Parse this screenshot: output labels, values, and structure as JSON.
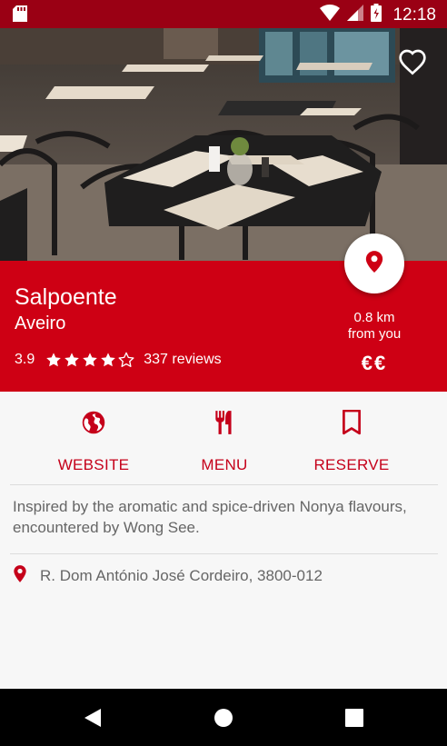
{
  "status_bar": {
    "time": "12:18"
  },
  "restaurant": {
    "name": "Salpoente",
    "city": "Aveiro",
    "rating": "3.9",
    "stars": 4,
    "max_stars": 5,
    "reviews": "337 reviews",
    "distance_line1": "0.8 km",
    "distance_line2": "from you",
    "price": "€€"
  },
  "actions": [
    {
      "label": "WEBSITE",
      "icon": "globe-icon"
    },
    {
      "label": "MENU",
      "icon": "fork-knife-icon"
    },
    {
      "label": "RESERVE",
      "icon": "bookmark-icon"
    }
  ],
  "description": "Inspired by the aromatic and spice-driven Nonya flavours, encountered by Wong See.",
  "address": "R. Dom António José Cordeiro, 3800-012",
  "colors": {
    "status_bar": "#9a0014",
    "accent": "#ce0014",
    "action_text": "#c5001a"
  }
}
